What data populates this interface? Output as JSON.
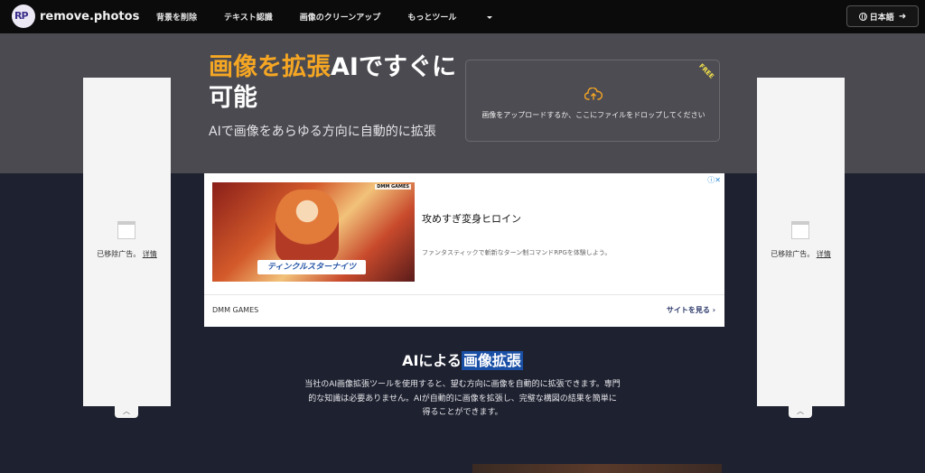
{
  "nav": {
    "logo_mark": "RP",
    "logo_text": "remove.photos",
    "links": [
      "背景を削除",
      "テキスト認識",
      "画像のクリーンアップ",
      "もっとツール"
    ],
    "language": "日本語"
  },
  "hero": {
    "title_highlight": "画像を拡張",
    "title_rest": "AIですぐに可能",
    "subtitle": "AIで画像をあらゆる方向に自動的に拡張",
    "upload_text": "画像をアップロードするか、ここにファイルをドロップしてください",
    "badge": "FREE"
  },
  "side_ads": {
    "removed_text": "已移除广告。",
    "details_link": "详情"
  },
  "center_ad": {
    "brand_tag": "DMM GAMES",
    "image_logo": "ティンクルスターナイツ",
    "headline": "攻めすぎ変身ヒロイン",
    "description": "ファンタスティックで斬新なターン制コマンドRPGを体験しよう。",
    "advertiser": "DMM GAMES",
    "cta": "サイトを見る"
  },
  "section": {
    "title_plain": "AIによる",
    "title_selected": "画像拡張",
    "body": "当社のAI画像拡張ツールを使用すると、望む方向に画像を自動的に拡張できます。専門的な知識は必要ありません。AIが自動的に画像を拡張し、完璧な構図の結果を簡単に得ることができます。"
  },
  "colors": {
    "accent": "#f5a623",
    "nav_bg": "#0b0b0c",
    "hero_bg": "#4b4a50",
    "page_bg": "#1e2130",
    "selection": "#1a4fa6"
  }
}
